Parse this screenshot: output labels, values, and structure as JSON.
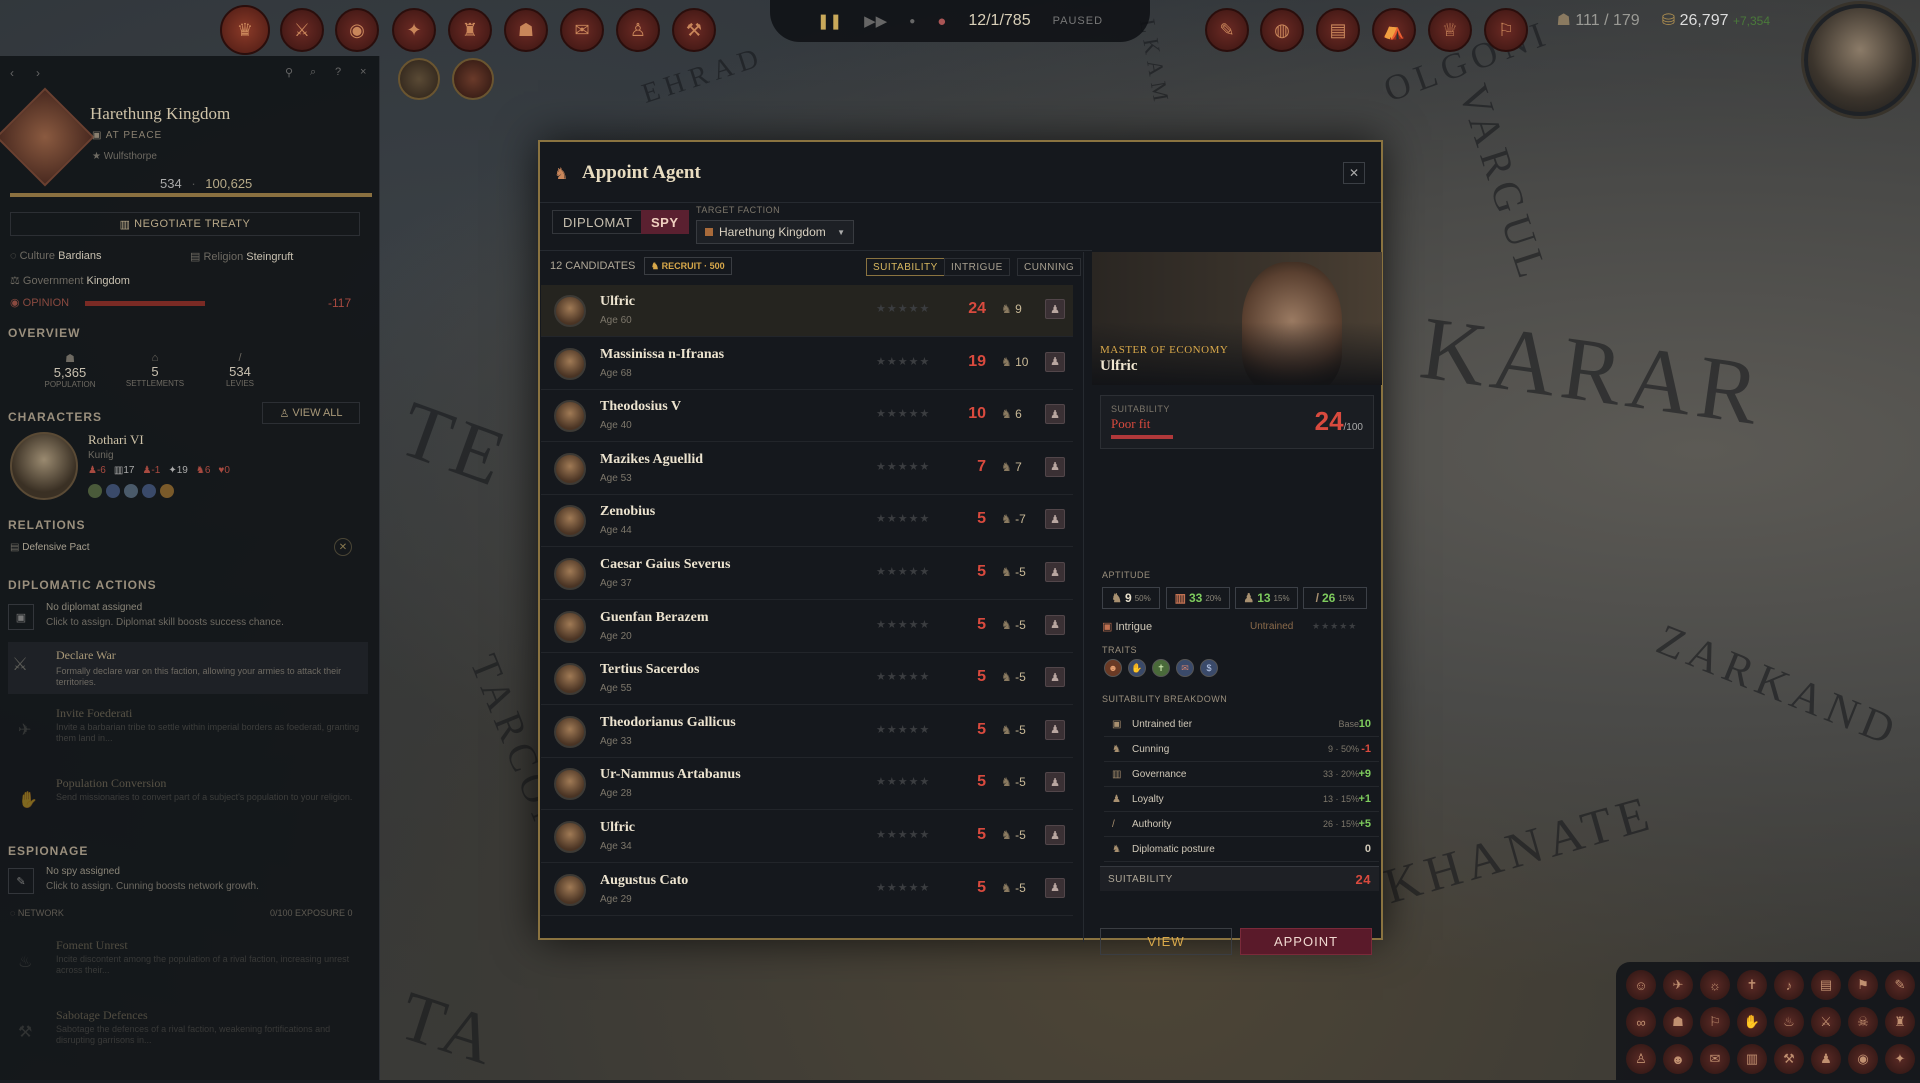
{
  "topbar": {
    "date": "12/1/785",
    "status": "PAUSED",
    "manpower": "111 / 179",
    "gold": "26,797",
    "gold_delta": "+7,354"
  },
  "left_panel": {
    "faction_name": "Harethung Kingdom",
    "peace_status": "AT PEACE",
    "capital": "Wulfsthorpe",
    "army_value": "534",
    "treasury_value": "100,625",
    "negotiate_label": "NEGOTIATE TREATY",
    "culture_label": "Culture",
    "culture": "Bardians",
    "religion_label": "Religion",
    "religion": "Steingruft",
    "government_label": "Government",
    "government": "Kingdom",
    "opinion_label": "OPINION",
    "opinion": "-117",
    "overview_label": "OVERVIEW",
    "population": "5,365",
    "population_label": "POPULATION",
    "settlements": "5",
    "settlements_label": "SETTLEMENTS",
    "levies": "534",
    "levies_label": "LEVIES",
    "characters_label": "CHARACTERS",
    "view_all": "VIEW ALL",
    "ruler_name": "Rothari VI",
    "ruler_title": "Kunig",
    "ruler_stats": [
      "-6",
      "17",
      "-1",
      "19",
      "6",
      "0"
    ],
    "relations_label": "RELATIONS",
    "relation": "Defensive Pact",
    "diplo_actions_label": "DIPLOMATIC ACTIONS",
    "no_diplomat": "No diplomat assigned",
    "no_diplomat_hint": "Click to assign. Diplomat skill boosts success chance.",
    "actions": [
      {
        "title": "Declare War",
        "desc": "Formally declare war on this faction, allowing your armies to attack their territories."
      },
      {
        "title": "Invite Foederati",
        "desc": "Invite a barbarian tribe to settle within imperial borders as foederati, granting them land in..."
      },
      {
        "title": "Population Conversion",
        "desc": "Send missionaries to convert part of a subject's population to your religion."
      }
    ],
    "espionage_label": "ESPIONAGE",
    "no_spy": "No spy assigned",
    "no_spy_hint": "Click to assign. Cunning boosts network growth.",
    "network_label": "NETWORK",
    "network_value": "0/100",
    "exposure": "EXPOSURE 0",
    "spy_actions": [
      {
        "title": "Foment Unrest",
        "desc": "Incite discontent among the population of a rival faction, increasing unrest across their..."
      },
      {
        "title": "Sabotage Defences",
        "desc": "Sabotage the defences of a rival faction, weakening fortifications and disrupting garrisons in..."
      }
    ]
  },
  "map_labels": [
    "KARAR",
    "ZARKAND",
    "KHANATE",
    "VARGUL",
    "TARCONNUS",
    "OLGONI",
    "EHRAD",
    "LKAM",
    "TE",
    "TA"
  ],
  "modal": {
    "title": "Appoint Agent",
    "tab_diplomat": "DIPLOMAT",
    "tab_spy": "SPY",
    "target_label": "TARGET FACTION",
    "target_value": "Harethung Kingdom",
    "candidates": "12 CANDIDATES",
    "recruit": "RECRUIT · 500",
    "sort_suitability": "SUITABILITY",
    "sort_intrigue": "INTRIGUE",
    "sort_cunning": "CUNNING",
    "rows": [
      {
        "name": "Ulfric",
        "age": "Age 60",
        "score": "24",
        "delta": "9"
      },
      {
        "name": "Massinissa n-Ifranas",
        "age": "Age 68",
        "score": "19",
        "delta": "10"
      },
      {
        "name": "Theodosius V",
        "age": "Age 40",
        "score": "10",
        "delta": "6"
      },
      {
        "name": "Mazikes Aguellid",
        "age": "Age 53",
        "score": "7",
        "delta": "7"
      },
      {
        "name": "Zenobius",
        "age": "Age 44",
        "score": "5",
        "delta": "-7"
      },
      {
        "name": "Caesar Gaius Severus",
        "age": "Age 37",
        "score": "5",
        "delta": "-5"
      },
      {
        "name": "Guenfan Berazem",
        "age": "Age 20",
        "score": "5",
        "delta": "-5"
      },
      {
        "name": "Tertius Sacerdos",
        "age": "Age 55",
        "score": "5",
        "delta": "-5"
      },
      {
        "name": "Theodorianus Gallicus",
        "age": "Age 33",
        "score": "5",
        "delta": "-5"
      },
      {
        "name": "Ur-Nammus Artabanus",
        "age": "Age 28",
        "score": "5",
        "delta": "-5"
      },
      {
        "name": "Ulfric",
        "age": "Age 34",
        "score": "5",
        "delta": "-5"
      },
      {
        "name": "Augustus Cato",
        "age": "Age 29",
        "score": "5",
        "delta": "-5"
      }
    ],
    "detail": {
      "role": "MASTER OF ECONOMY",
      "name": "Ulfric",
      "suitability_label": "SUITABILITY",
      "fit": "Poor fit",
      "score": "24",
      "max": "/100",
      "aptitude_label": "APTITUDE",
      "aptitudes": [
        {
          "value": "9",
          "pct": "50%"
        },
        {
          "value": "33",
          "pct": "20%"
        },
        {
          "value": "13",
          "pct": "15%"
        },
        {
          "value": "26",
          "pct": "15%"
        }
      ],
      "intrigue_label": "Intrigue",
      "intrigue_status": "Untrained",
      "traits_label": "TRAITS",
      "breakdown_label": "SUITABILITY BREAKDOWN",
      "breakdown": [
        {
          "label": "Untrained tier",
          "meta": "Base",
          "value": "10"
        },
        {
          "label": "Cunning",
          "meta": "9 · 50%",
          "value": "-1"
        },
        {
          "label": "Governance",
          "meta": "33 · 20%",
          "value": "+9"
        },
        {
          "label": "Loyalty",
          "meta": "13 · 15%",
          "value": "+1"
        },
        {
          "label": "Authority",
          "meta": "26 · 15%",
          "value": "+5"
        },
        {
          "label": "Diplomatic posture",
          "meta": "",
          "value": "0"
        }
      ],
      "total_label": "SUITABILITY",
      "total": "24",
      "view_label": "VIEW",
      "appoint_label": "APPOINT"
    }
  }
}
